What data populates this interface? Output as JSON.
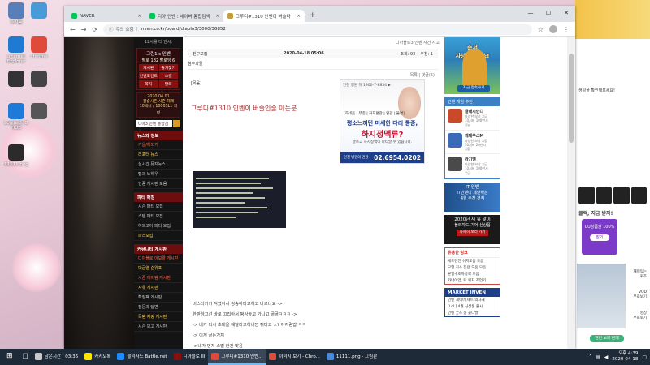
{
  "desktop": {
    "icons": [
      {
        "label": "휴지통",
        "color": "#5a7fb8"
      },
      {
        "label": "",
        "color": "#4a9ad8"
      },
      {
        "label": "Internet Explorer",
        "color": "#1f7ad4"
      },
      {
        "label": "chrome",
        "color": "#e04a3a"
      },
      {
        "label": "",
        "color": "#333333"
      },
      {
        "label": "",
        "color": "#444444"
      },
      {
        "label": "Logitech G HUB",
        "color": "#1d7ad8"
      },
      {
        "label": "",
        "color": "#555555"
      },
      {
        "label": "11111.png",
        "color": "#2b2b2b"
      }
    ]
  },
  "browser": {
    "tabs": [
      {
        "label": "NAVER",
        "icon_color": "#03c75a",
        "active": false
      },
      {
        "label": "디아 인벤 : 네이버 통합검색",
        "icon_color": "#03c75a",
        "active": false
      },
      {
        "label": "그루디#1310 인벤이 버슬라",
        "icon_color": "#c4a03a",
        "active": true
      }
    ],
    "new_tab": "+",
    "window_buttons": {
      "min": "—",
      "max": "☐",
      "close": "✕"
    },
    "address": {
      "security": "주의 요함",
      "url": "inven.co.kr/board/diablo3/3000/36852"
    }
  },
  "sidebar": {
    "top_text": "12시를 더 안시.",
    "user": {
      "name": "그린1's 인벤",
      "counts": "팔로 182   팔로잉 6"
    },
    "grid": [
      "게시판",
      "즐겨찾기",
      "인벤포인트",
      "스킬",
      "쪽지",
      "탈퇴"
    ],
    "news": "2020.04.01\n결승시즌 시즌 해제\n10베니 / 1000SL1 지급",
    "search_value": "디아3 인벤 통합검색",
    "sections": [
      {
        "title": "뉴스와 정보",
        "items": [
          {
            "label": "가을/해외기",
            "style": "red"
          },
          {
            "label": "리포터 뉴스",
            "style": "hl"
          },
          {
            "label": "실시간 뮤지뉴스",
            "style": ""
          },
          {
            "label": "팁과 노하우",
            "style": ""
          },
          {
            "label": "인증 게시판 모음",
            "style": ""
          }
        ]
      },
      {
        "title": "파티 매칭",
        "items": [
          {
            "label": "시즌 파티 모집",
            "style": ""
          },
          {
            "label": "스탠 파티 모집",
            "style": ""
          },
          {
            "label": "하드코어 파티 모집",
            "style": ""
          },
          {
            "label": "파스모집",
            "style": "hl"
          }
        ]
      },
      {
        "title": "커뮤니티 게시판",
        "items": [
          {
            "label": "디아블로 이모랄 게시판",
            "style": "red"
          },
          {
            "label": "대균열 순위표",
            "style": "hl"
          },
          {
            "label": "시즌 아이템 게시판",
            "style": "red"
          },
          {
            "label": "자유 게시판",
            "style": "hl"
          },
          {
            "label": "확장팩 게시판",
            "style": ""
          },
          {
            "label": "질문과 답변",
            "style": ""
          },
          {
            "label": "득템 자랑 게시판",
            "style": "hl"
          },
          {
            "label": "시즌 보고 게시판",
            "style": ""
          }
        ]
      }
    ]
  },
  "post": {
    "breadcrumb": "디아블로3 인벤 사건 사고",
    "category": "친구모집",
    "date": "2020-04-18 05:06",
    "views": "조회: 93",
    "recommend": "추천: 1",
    "attachment": "첨부파일",
    "tools": "목록 | 댓글(5)",
    "quote_tag": "[목음]",
    "title": "그루디#1310 인벤이 버슬인줄 아는분",
    "body_lines": [
      "버스타기가 적었어서 청승하다고하고 바르나요 ->",
      "한판하고선 바로 끄집아서 펑상높고 가니고 골골ㅋㅋㅋ  ->",
      "-> 내가 다시 초대을 해달라고하니깐 튀다고 ㅅ? 어지럼밥 ㅋㅋ",
      "-> 이게 골든가지",
      "->내가 먼저 스벌 한건 맞음"
    ]
  },
  "ad": {
    "top": "인천 병원 뒤 1900-7-8854 ▶",
    "tags": "[하네움 | 부종 | 하지혈관 | 혈관 | 불면]",
    "line1": "평소느껴던 미세한 다리 통증,",
    "line2": "하지정맥류?",
    "line3": "날쓰고 하지정맥이 나타날 수 있습니다.",
    "clinic": "인천 병원의 건강",
    "phone": "02.6954.0202"
  },
  "rail": {
    "game_title": "순서\n사냥하러가쇼!",
    "game_btn": "지금 접속하기",
    "rec_title": "인벤 게임 추천",
    "recs": [
      {
        "name": "클래시인디",
        "desc": "다양한 보상 지급\n10서버 100만시\n지급",
        "color": "#c84a2a"
      },
      {
        "name": "케페우스M",
        "desc": "다양한 보상 지급\n50서버 20만시\n지급",
        "color": "#3a6ab8"
      },
      {
        "name": "라기엠",
        "desc": "다양한 보상 지급\n10서버 100만시\n지급",
        "color": "#4a4a4a"
      }
    ],
    "it_title": "IT 인벤",
    "it_sub": "IT인벤이 제안하는\n4월 추천 견적",
    "bliz_title": "2020년 새 뮤 맞이",
    "bliz_sub": "블리자드 기어 신상품",
    "bliz_btn": "자세히 보러 가기",
    "list_title": "유용한 링크",
    "list": [
      "세트던전 쉬지도움 모음",
      "모험 최소 전용 도움 모음",
      "균열수호자공략 모음",
      "카나이업, 탁 위치 조언기"
    ],
    "market_title": "MARKET INVEN",
    "market_items": [
      "인벤 게이머 세트 의자개",
      "[LoL] 4월 신상품 출시",
      "인벤 굿즈 봉 꽃다발"
    ]
  },
  "right_panel": {
    "msg": "생일을 확인해보세요!",
    "promo": "클럭, 지금 받자!",
    "cu_title": "CU상품권 100%",
    "cu_btn": "받기",
    "list": [
      "재미있는\n퀴즈",
      "VOD\n무료보기",
      "영상\n무료보기"
    ],
    "weather_btn": "현민 보배 판매"
  },
  "taskbar": {
    "items": [
      {
        "label": "남은시간 : 03:36",
        "color": "#c8c8c8",
        "active": false
      },
      {
        "label": "카카오톡",
        "color": "#fee500",
        "active": false
      },
      {
        "label": "블리자드 Battle.net",
        "color": "#1a8cff",
        "active": false
      },
      {
        "label": "디아블로 III",
        "color": "#8a1010",
        "active": false
      },
      {
        "label": "그루디#1310 인벤...",
        "color": "#e04a3a",
        "active": true
      },
      {
        "label": "이미지 보기 - Chro...",
        "color": "#e04a3a",
        "active": false
      },
      {
        "label": "11111.png - 그림판",
        "color": "#4a8ad8",
        "active": false
      }
    ],
    "time": "오후 4:39",
    "date": "2020-04-18"
  }
}
